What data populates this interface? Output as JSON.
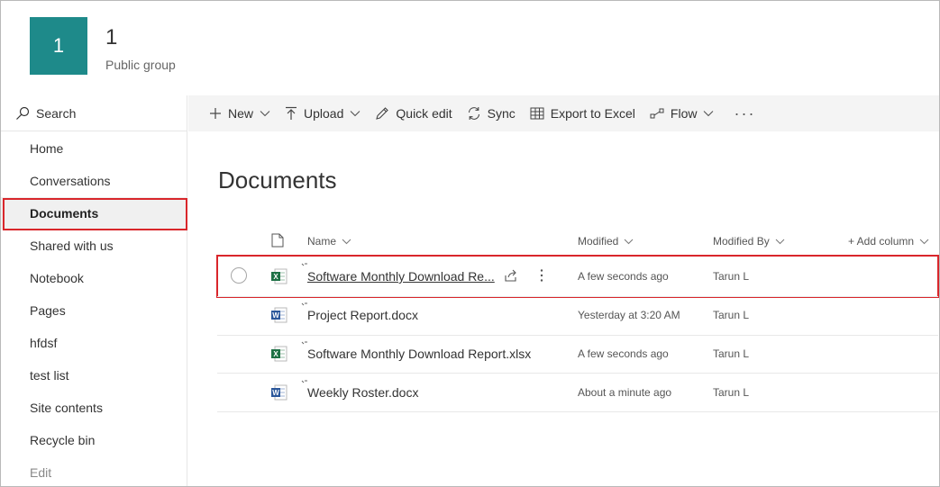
{
  "site": {
    "logo_text": "1",
    "title": "1",
    "subtitle": "Public group",
    "logo_color": "#1e8a8a"
  },
  "leftnav": {
    "search_label": "Search",
    "items": [
      {
        "label": "Home"
      },
      {
        "label": "Conversations"
      },
      {
        "label": "Documents",
        "selected": true
      },
      {
        "label": "Shared with us"
      },
      {
        "label": "Notebook"
      },
      {
        "label": "Pages"
      },
      {
        "label": "hfdsf"
      },
      {
        "label": "test list"
      },
      {
        "label": "Site contents"
      },
      {
        "label": "Recycle bin"
      },
      {
        "label": "Edit"
      }
    ]
  },
  "toolbar": {
    "new_label": "New",
    "upload_label": "Upload",
    "quick_edit_label": "Quick edit",
    "sync_label": "Sync",
    "export_label": "Export to Excel",
    "flow_label": "Flow",
    "more_label": "···"
  },
  "main": {
    "title": "Documents",
    "columns": {
      "name": "Name",
      "modified": "Modified",
      "modified_by": "Modified By",
      "add_column": "+ Add column"
    },
    "rows": [
      {
        "name": "Software Monthly Download Re...",
        "type": "excel",
        "modified": "A few seconds ago",
        "modified_by": "Tarun L"
      },
      {
        "name": "Project Report.docx",
        "type": "word",
        "modified": "Yesterday at 3:20 AM",
        "modified_by": "Tarun L"
      },
      {
        "name": "Software Monthly Download Report.xlsx",
        "type": "excel",
        "modified": "A few seconds ago",
        "modified_by": "Tarun L"
      },
      {
        "name": "Weekly Roster.docx",
        "type": "word",
        "modified": "About a minute ago",
        "modified_by": "Tarun L"
      }
    ]
  },
  "colors": {
    "highlight": "#d9262b",
    "excel": "#1e7145",
    "word": "#2b579a"
  }
}
